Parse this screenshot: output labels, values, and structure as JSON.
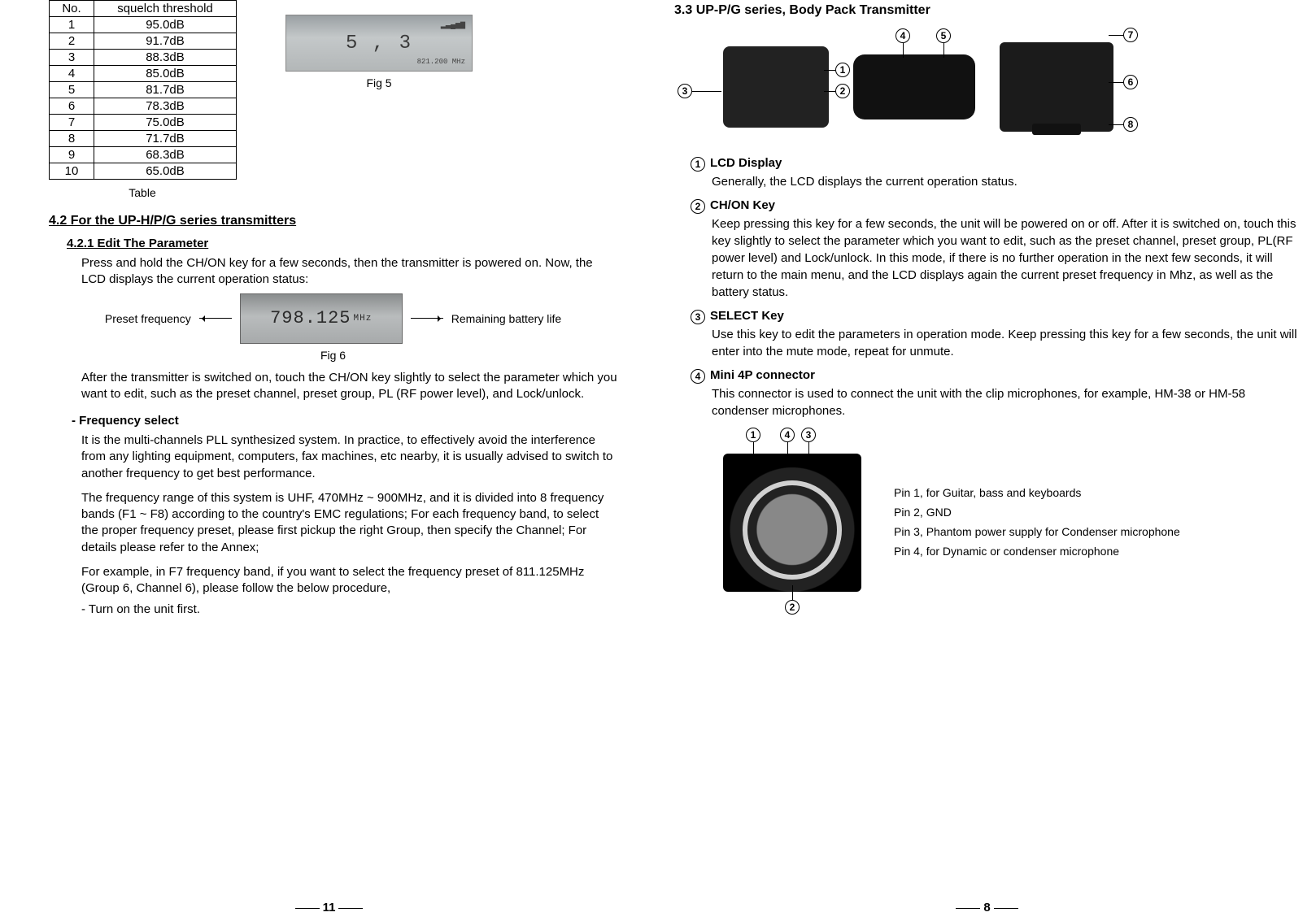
{
  "left": {
    "table": {
      "headers": {
        "no": "No.",
        "squelch": "squelch threshold"
      },
      "rows": [
        {
          "no": "1",
          "val": "95.0dB"
        },
        {
          "no": "2",
          "val": "91.7dB"
        },
        {
          "no": "3",
          "val": "88.3dB"
        },
        {
          "no": "4",
          "val": "85.0dB"
        },
        {
          "no": "5",
          "val": "81.7dB"
        },
        {
          "no": "6",
          "val": "78.3dB"
        },
        {
          "no": "7",
          "val": "75.0dB"
        },
        {
          "no": "8",
          "val": "71.7dB"
        },
        {
          "no": "9",
          "val": "68.3dB"
        },
        {
          "no": "10",
          "val": "65.0dB"
        }
      ],
      "caption": "Table"
    },
    "fig5": {
      "display": "5 ,  3",
      "sub1": "▂▃▄▅▆",
      "sub2": "821.200 MHz",
      "caption": "Fig 5"
    },
    "sec42": "4.2 For the UP-H/P/G series transmitters",
    "sec421": "4.2.1 Edit The Parameter",
    "para1": "Press and hold the CH/ON key for a few seconds, then the transmitter is powered on. Now, the LCD displays the current operation status:",
    "fig6": {
      "left_label": "Preset frequency",
      "display": "798.125",
      "mhz": "MHz",
      "right_label": "Remaining battery life",
      "caption": "Fig 6"
    },
    "para2": "After the transmitter is switched on, touch the CH/ON  key slightly to select the parameter which you want to edit, such as the preset channel, preset group, PL (RF power level), and Lock/unlock.",
    "freq_head": "-  Frequency select",
    "para3": "It is the multi-channels PLL synthesized system. In practice, to effectively avoid the interference from any lighting equipment, computers, fax machines, etc nearby, it is usually advised to switch to another frequency to get best performance.",
    "para4": "The frequency range of this system is UHF, 470MHz ~ 900MHz, and it is divided into 8 frequency bands (F1 ~ F8) according to the country's EMC regulations; For each frequency band, to select the proper frequency preset, please first pickup the right Group, then specify the Channel; For details please refer to the Annex;",
    "para5": "For example, in F7 frequency band, if you want to select the frequency preset of 811.125MHz (Group 6, Channel 6),   please follow the below procedure,",
    "para6": "- Turn on the unit first.",
    "page_num": "11"
  },
  "right": {
    "sec33": "3.3 UP-P/G series, Body Pack Transmitter",
    "callouts": {
      "c1": "1",
      "c2": "2",
      "c3": "3",
      "c4": "4",
      "c5": "5",
      "c6": "6",
      "c7": "7",
      "c8": "8"
    },
    "items": [
      {
        "num": "1",
        "title": "LCD Display",
        "body": "Generally, the LCD displays the current operation status."
      },
      {
        "num": "2",
        "title": "CH/ON Key",
        "body": "Keep pressing this key for a few seconds, the unit will be powered on or off. After it is switched on, touch this key slightly to select the parameter which you want to edit, such as the preset channel, preset group, PL(RF power  level) and Lock/unlock. In this mode, if there is no further operation in the next few seconds, it will return to the main menu, and the LCD displays again the current preset frequency in Mhz, as well as the battery status."
      },
      {
        "num": "3",
        "title": "SELECT Key",
        "body": "Use this key to edit the parameters in operation mode. Keep pressing this key for a few seconds, the unit will enter into the mute mode, repeat for unmute."
      },
      {
        "num": "4",
        "title": "Mini 4P connector",
        "body": "This connector is used to connect the unit with the clip microphones, for example, HM-38 or HM-58 condenser microphones."
      }
    ],
    "connector": {
      "top_labels": {
        "a": "1",
        "b": "4",
        "c": "3"
      },
      "bottom_label": "2",
      "pins": [
        "Pin 1, for Guitar, bass and keyboards",
        "Pin 2, GND",
        "Pin 3, Phantom power supply for Condenser microphone",
        "Pin 4, for Dynamic or condenser microphone"
      ]
    },
    "page_num": "8"
  }
}
